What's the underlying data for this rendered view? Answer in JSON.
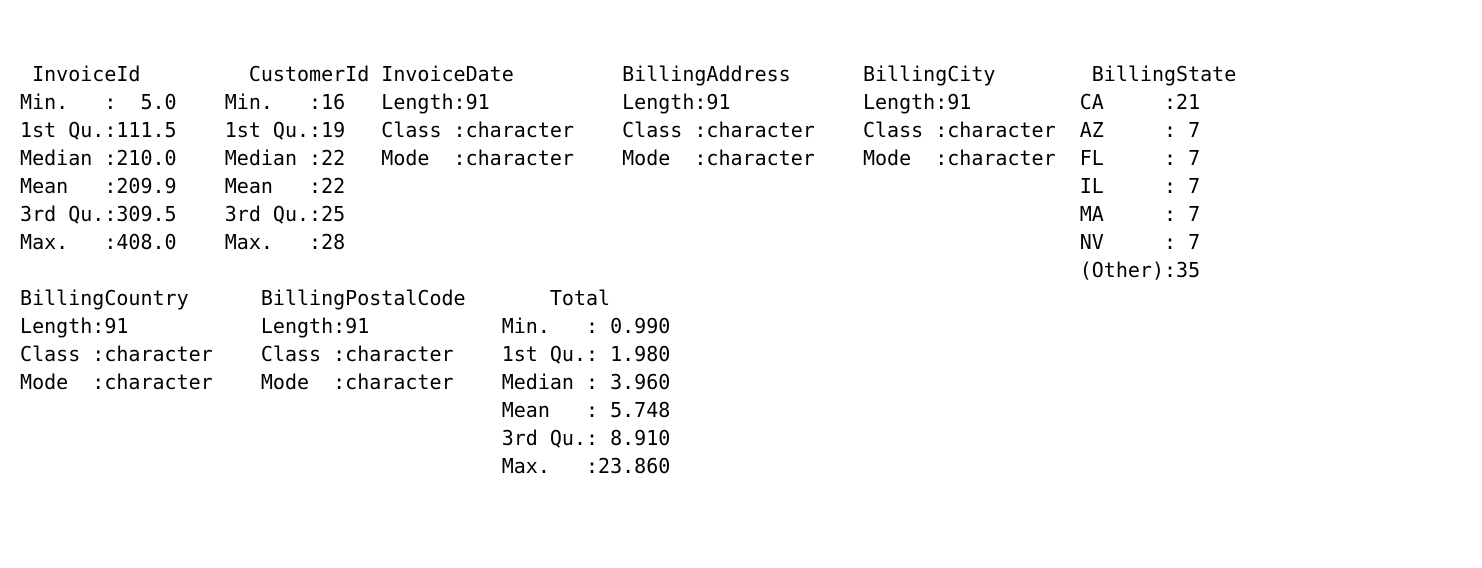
{
  "row1": {
    "col1": {
      "header": "  InvoiceId   ",
      "lines": [
        " Min.   :  5.0",
        " 1st Qu.:111.5",
        " Median :210.0",
        " Mean   :209.9",
        " 3rd Qu.:309.5",
        " Max.   :408.0",
        "              "
      ]
    },
    "col2": {
      "header": "   CustomerId",
      "lines": [
        " Min.   :16  ",
        " 1st Qu.:19  ",
        " Median :22  ",
        " Mean   :22  ",
        " 3rd Qu.:25  ",
        " Max.   :28  ",
        "             "
      ]
    },
    "col3": {
      "header": " InvoiceDate      ",
      "lines": [
        " Length:91        ",
        " Class :character ",
        " Mode  :character ",
        "                  ",
        "                  ",
        "                  ",
        "                  "
      ]
    },
    "col4": {
      "header": " BillingAddress   ",
      "lines": [
        " Length:91        ",
        " Class :character ",
        " Mode  :character ",
        "                  ",
        "                  ",
        "                  ",
        "                  "
      ]
    },
    "col5": {
      "header": " BillingCity      ",
      "lines": [
        " Length:91        ",
        " Class :character ",
        " Mode  :character ",
        "                  ",
        "                  ",
        "                  ",
        "                  "
      ]
    },
    "col6": {
      "header": "  BillingState",
      "lines": [
        " CA     :21  ",
        " AZ     : 7  ",
        " FL     : 7  ",
        " IL     : 7  ",
        " MA     : 7  ",
        " NV     : 7  ",
        " (Other):35  "
      ]
    }
  },
  "row2": {
    "col1": {
      "header": " BillingCountry   ",
      "lines": [
        " Length:91        ",
        " Class :character ",
        " Mode  :character ",
        "                  ",
        "                  ",
        "                  "
      ]
    },
    "col2": {
      "header": " BillingPostalCode",
      "lines": [
        " Length:91        ",
        " Class :character ",
        " Mode  :character ",
        "                  ",
        "                  ",
        "                  "
      ]
    },
    "col3": {
      "header": "     Total      ",
      "lines": [
        " Min.   : 0.990 ",
        " 1st Qu.: 1.980 ",
        " Median : 3.960 ",
        " Mean   : 5.748 ",
        " 3rd Qu.: 8.910 ",
        " Max.   :23.860 "
      ]
    }
  }
}
